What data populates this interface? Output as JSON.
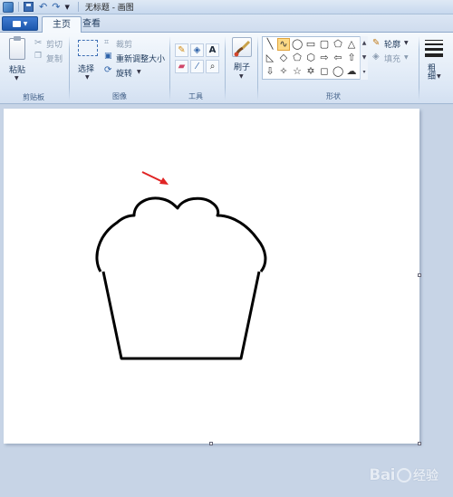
{
  "window": {
    "title": "无标题 - 画图"
  },
  "tabs": [
    {
      "label": "主页",
      "active": true
    },
    {
      "label": "查看",
      "active": false
    }
  ],
  "clipboard": {
    "paste_label": "粘贴",
    "cut_label": "剪切",
    "copy_label": "复制",
    "group_label": "剪贴板"
  },
  "image": {
    "select_label": "选择",
    "crop_label": "裁剪",
    "resize_label": "重新调整大小",
    "rotate_label": "旋转",
    "group_label": "图像"
  },
  "tools": {
    "group_label": "工具",
    "items": [
      "pencil-icon",
      "fill-icon",
      "text-icon",
      "eraser-icon",
      "color-picker-icon",
      "magnifier-icon"
    ]
  },
  "brushes": {
    "label": "刷子"
  },
  "shapes": {
    "group_label": "形状",
    "outline_label": "轮廓",
    "fill_label": "填充"
  },
  "size": {
    "label": "粗细"
  },
  "colors": {
    "accent": "#1c57ad",
    "ribbon_bg": "#dce7f5",
    "workspace": "#c7d4e6",
    "arrow": "#e02424",
    "stroke": "#000000"
  },
  "watermark": {
    "brand": "Bai",
    "suffix": "经验"
  }
}
